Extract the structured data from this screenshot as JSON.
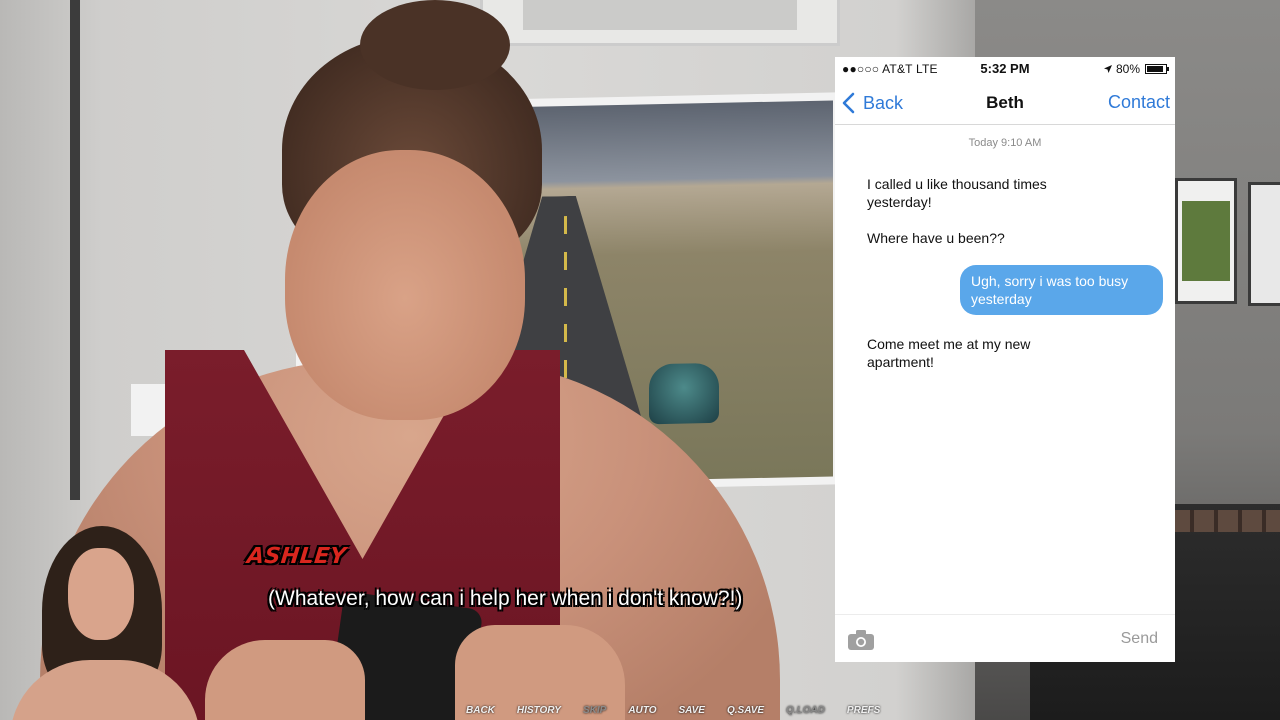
{
  "phone": {
    "status": {
      "carrier": "●●○○○ AT&T LTE",
      "time": "5:32 PM",
      "battery": "80%"
    },
    "nav": {
      "back_label": "Back",
      "title": "Beth",
      "contact_label": "Contact"
    },
    "timestamp": "Today 9:10 AM",
    "messages": [
      {
        "from": "contact",
        "text": "I called u like thousand times yesterday!"
      },
      {
        "from": "contact",
        "text": "Where have u been??"
      },
      {
        "from": "me",
        "text": "Ugh, sorry i was too busy yesterday"
      },
      {
        "from": "contact",
        "text": "Come meet me at my new apartment!"
      }
    ],
    "compose": {
      "send_label": "Send"
    },
    "colors": {
      "accent": "#2f7ad8",
      "outgoing_bubble": "#5aa7ea"
    }
  },
  "dialogue": {
    "speaker": "ASHLEY",
    "text": "(Whatever, how can i help her when i don't know?!)",
    "speaker_color": "#d8261e"
  },
  "quick_menu": {
    "items": [
      "BACK",
      "HISTORY",
      "SKIP",
      "AUTO",
      "SAVE",
      "Q.SAVE",
      "Q.LOAD",
      "PREFS"
    ]
  }
}
